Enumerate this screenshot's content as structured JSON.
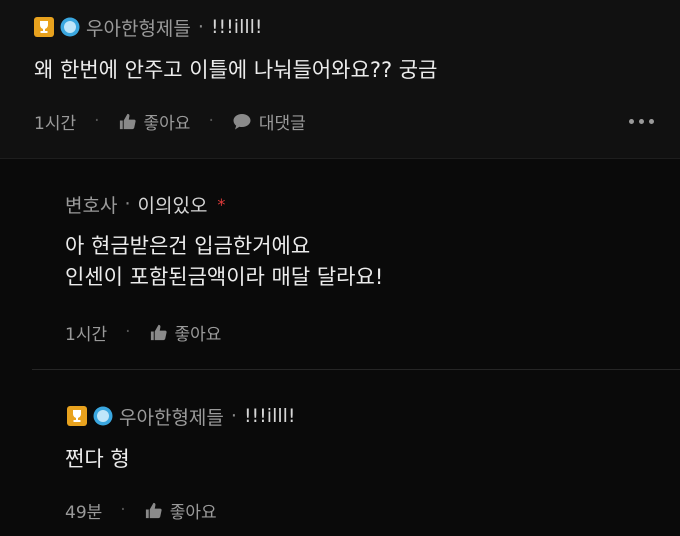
{
  "comments": [
    {
      "author": "우아한형제들",
      "tag": "!!!illl!",
      "lines": [
        "왜 한번에 안주고 이틀에 나눠들어와요?? 궁금"
      ],
      "time": "1시간",
      "like_label": "좋아요",
      "reply_label": "대댓글"
    },
    {
      "author": "변호사",
      "tag": "이의있오",
      "marker": "*",
      "lines": [
        "아 현금받은건 입금한거에요",
        "인센이 포함된금액이라 매달 달라요!"
      ],
      "time": "1시간",
      "like_label": "좋아요"
    },
    {
      "author": "우아한형제들",
      "tag": "!!!illl!",
      "lines": [
        "쩐다 형"
      ],
      "time": "49분",
      "like_label": "좋아요"
    }
  ],
  "colors": {
    "background": "#0a0a0a",
    "highlight_background": "#111111",
    "badge_gold": "#e8a21e",
    "badge_blue": "#3aa7e0",
    "marker_red": "#e23b3b"
  },
  "icons": [
    "trophy-badge-icon",
    "round-badge-icon",
    "thumbs-up-icon",
    "speech-bubble-icon",
    "more-icon"
  ]
}
